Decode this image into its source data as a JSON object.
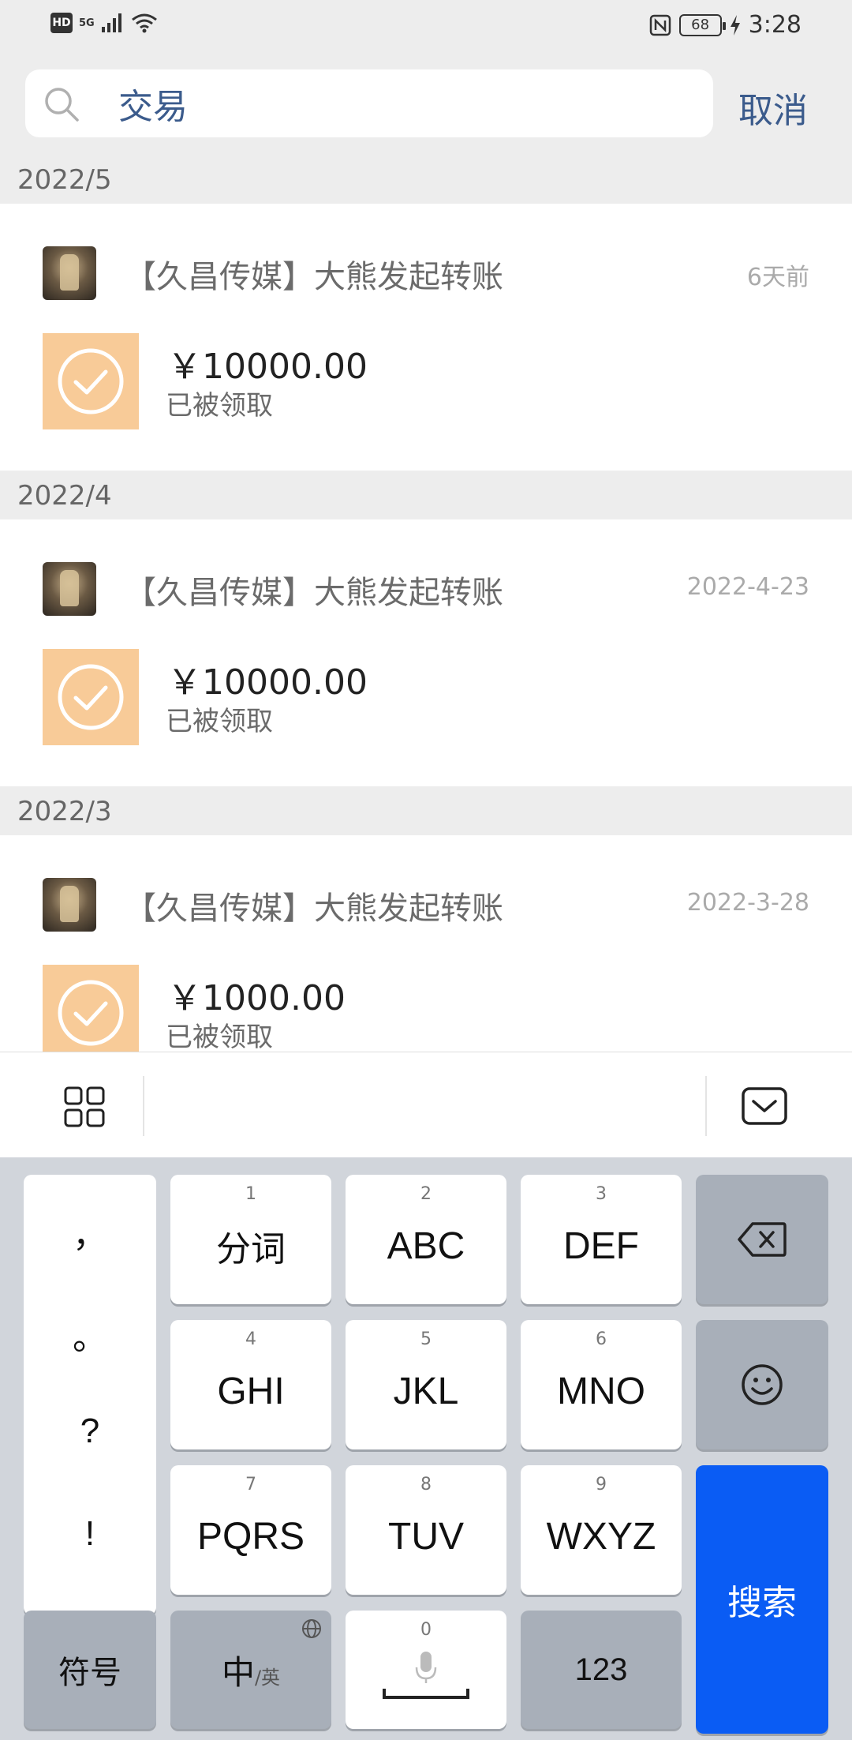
{
  "status": {
    "hd": "HD",
    "net": "5G",
    "battery": "68",
    "time": "3:28"
  },
  "search": {
    "value": "交易",
    "cancel": "取消"
  },
  "sections": [
    {
      "header": "2022/5",
      "title": "【久昌传媒】大熊发起转账",
      "time": "6天前",
      "amount": "￥10000.00",
      "status": "已被领取"
    },
    {
      "header": "2022/4",
      "title": "【久昌传媒】大熊发起转账",
      "time": "2022-4-23",
      "amount": "￥10000.00",
      "status": "已被领取"
    },
    {
      "header": "2022/3",
      "title": "【久昌传媒】大熊发起转账",
      "time": "2022-3-28",
      "amount": "￥1000.00",
      "status": "已被领取"
    }
  ],
  "keyboard": {
    "punctuation": [
      "，",
      "。",
      "?",
      "!"
    ],
    "keys": [
      {
        "num": "1",
        "label": "分词"
      },
      {
        "num": "2",
        "label": "ABC"
      },
      {
        "num": "3",
        "label": "DEF"
      },
      {
        "num": "4",
        "label": "GHI"
      },
      {
        "num": "5",
        "label": "JKL"
      },
      {
        "num": "6",
        "label": "MNO"
      },
      {
        "num": "7",
        "label": "PQRS"
      },
      {
        "num": "8",
        "label": "TUV"
      },
      {
        "num": "9",
        "label": "WXYZ"
      }
    ],
    "search": "搜索",
    "symbols": "符号",
    "lang_main": "中",
    "lang_sub": "/英",
    "space_num": "0",
    "num_mode": "123"
  },
  "colors": {
    "accent": "#3b5b8c",
    "search_key": "#0a5cf4",
    "received_icon_bg": "#f8cb98"
  }
}
